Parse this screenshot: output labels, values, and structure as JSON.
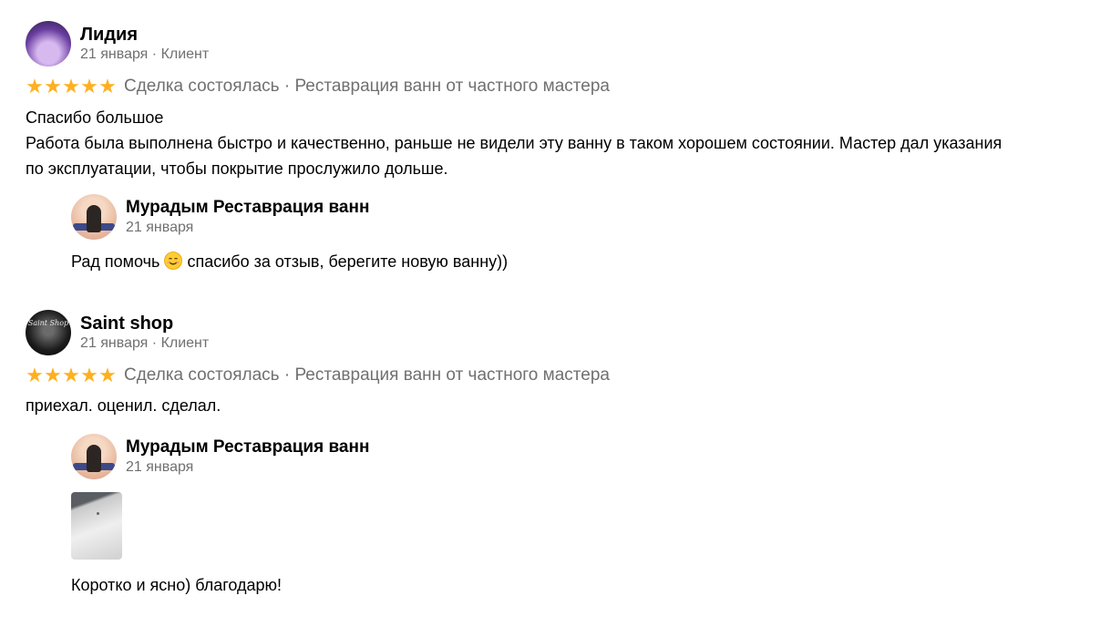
{
  "reviews": [
    {
      "author": "Лидия",
      "meta": "21 января · Клиент",
      "deal": "Сделка состоялась · Реставрация ванн от частного мастера",
      "rating": 5,
      "text_lines": [
        "Спасибо большое",
        "Работа была выполнена быстро и качественно, раньше не видели эту ванну в таком хорошем состоянии. Мастер дал указания",
        "по эксплуатации, чтобы покрытие прослужило дольше."
      ],
      "reply": {
        "author": "Мурадым Реставрация ванн",
        "date": "21 января",
        "text_before": "Рад помочь",
        "text_after": "спасибо за отзыв, берегите новую ванну))"
      }
    },
    {
      "author": "Saint shop",
      "avatar_text": "Saint Shop",
      "meta": "21 января · Клиент",
      "deal": "Сделка состоялась · Реставрация ванн от частного мастера",
      "rating": 5,
      "text_lines": [
        "приехал. оценил. сделал."
      ],
      "reply": {
        "author": "Мурадым Реставрация ванн",
        "date": "21 января",
        "text": "Коротко и ясно) благодарю!"
      }
    }
  ],
  "colors": {
    "star": "#ffb021",
    "muted": "#707070"
  },
  "icons": {
    "star": "star-icon",
    "emoji": "smiling-face-icon"
  }
}
